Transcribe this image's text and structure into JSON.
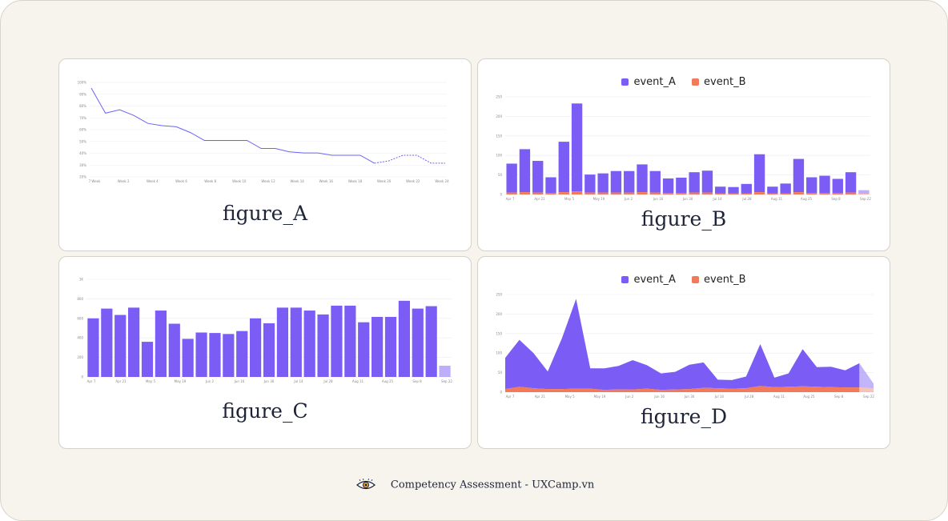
{
  "footer": {
    "text": "Competency Assessment - UXCamp.vn",
    "logo_icon": "eye-icon"
  },
  "colors": {
    "event_A": "#7b5cf5",
    "event_B": "#f07a5a",
    "line": "#6b63f5",
    "grid": "#ececf2"
  },
  "chart_data": [
    {
      "id": "A",
      "type": "line",
      "caption": "figure_A",
      "x_ticks": [
        "7 Week",
        "Week 2",
        "Week 4",
        "Week 6",
        "Week 8",
        "Week 10",
        "Week 12",
        "Week 14",
        "Week 16",
        "Week 18",
        "Week 20",
        "Week 22",
        "Week 24"
      ],
      "y_ticks": [
        "100%",
        "90%",
        "80%",
        "70%",
        "60%",
        "50%",
        "40%",
        "30%",
        "20%"
      ],
      "ylim": [
        17,
        100
      ],
      "values": [
        95,
        73,
        76,
        71,
        64,
        62,
        61,
        56,
        49,
        49,
        49,
        49,
        42,
        42,
        39,
        38,
        38,
        36,
        36,
        36,
        29,
        31,
        36,
        36,
        29,
        29
      ],
      "dashed_from_index": 20
    },
    {
      "id": "B",
      "type": "bar",
      "caption": "figure_B",
      "legend": [
        "event_A",
        "event_B"
      ],
      "x_ticks": [
        "Apr 7",
        "Apr 21",
        "May 5",
        "May 19",
        "Jun 2",
        "Jun 16",
        "Jun 30",
        "Jul 14",
        "Jul 28",
        "Aug 11",
        "Aug 25",
        "Sep 8",
        "Sep 22"
      ],
      "y_ticks": [
        "250",
        "200",
        "150",
        "100",
        "50",
        "0"
      ],
      "ylim": [
        0,
        250
      ],
      "series": [
        {
          "name": "event_A",
          "values": [
            74,
            110,
            81,
            40,
            129,
            225,
            46,
            49,
            55,
            55,
            71,
            55,
            37,
            39,
            52,
            56,
            17,
            16,
            24,
            97,
            17,
            25,
            85,
            40,
            44,
            36,
            52,
            9
          ]
        },
        {
          "name": "event_B",
          "values": [
            5,
            6,
            5,
            4,
            6,
            8,
            5,
            5,
            5,
            5,
            6,
            5,
            4,
            4,
            5,
            5,
            3,
            3,
            3,
            6,
            3,
            3,
            6,
            4,
            4,
            4,
            5,
            2
          ]
        }
      ]
    },
    {
      "id": "C",
      "type": "bar",
      "caption": "figure_C",
      "x_ticks": [
        "Apr 7",
        "Apr 21",
        "May 5",
        "May 19",
        "Jun 2",
        "Jun 16",
        "Jun 30",
        "Jul 14",
        "Jul 28",
        "Aug 11",
        "Aug 25",
        "Sep 8",
        "Sep 22"
      ],
      "y_ticks": [
        "1K",
        "800",
        "600",
        "400",
        "200",
        "0"
      ],
      "ylim": [
        0,
        1000
      ],
      "values": [
        600,
        700,
        635,
        710,
        360,
        680,
        545,
        390,
        455,
        450,
        440,
        470,
        600,
        550,
        710,
        710,
        680,
        640,
        730,
        730,
        560,
        615,
        615,
        780,
        700,
        725,
        115
      ]
    },
    {
      "id": "D",
      "type": "area",
      "caption": "figure_D",
      "legend": [
        "event_A",
        "event_B"
      ],
      "x_ticks": [
        "Apr 7",
        "Apr 21",
        "May 5",
        "May 19",
        "Jun 2",
        "Jun 16",
        "Jun 30",
        "Jul 14",
        "Jul 28",
        "Aug 11",
        "Aug 25",
        "Sep 8",
        "Sep 22"
      ],
      "y_ticks": [
        "250",
        "200",
        "150",
        "100",
        "50",
        "0"
      ],
      "ylim": [
        0,
        250
      ],
      "series": [
        {
          "name": "event_A",
          "values": [
            80,
            120,
            90,
            45,
            130,
            230,
            52,
            55,
            60,
            75,
            60,
            42,
            45,
            62,
            65,
            22,
            22,
            30,
            107,
            24,
            34,
            95,
            50,
            52,
            44,
            62,
            12
          ]
        },
        {
          "name": "event_B",
          "values": [
            8,
            14,
            10,
            8,
            8,
            9,
            9,
            6,
            7,
            7,
            9,
            6,
            7,
            8,
            11,
            10,
            9,
            10,
            16,
            13,
            14,
            15,
            14,
            13,
            12,
            12,
            10
          ]
        }
      ]
    }
  ]
}
